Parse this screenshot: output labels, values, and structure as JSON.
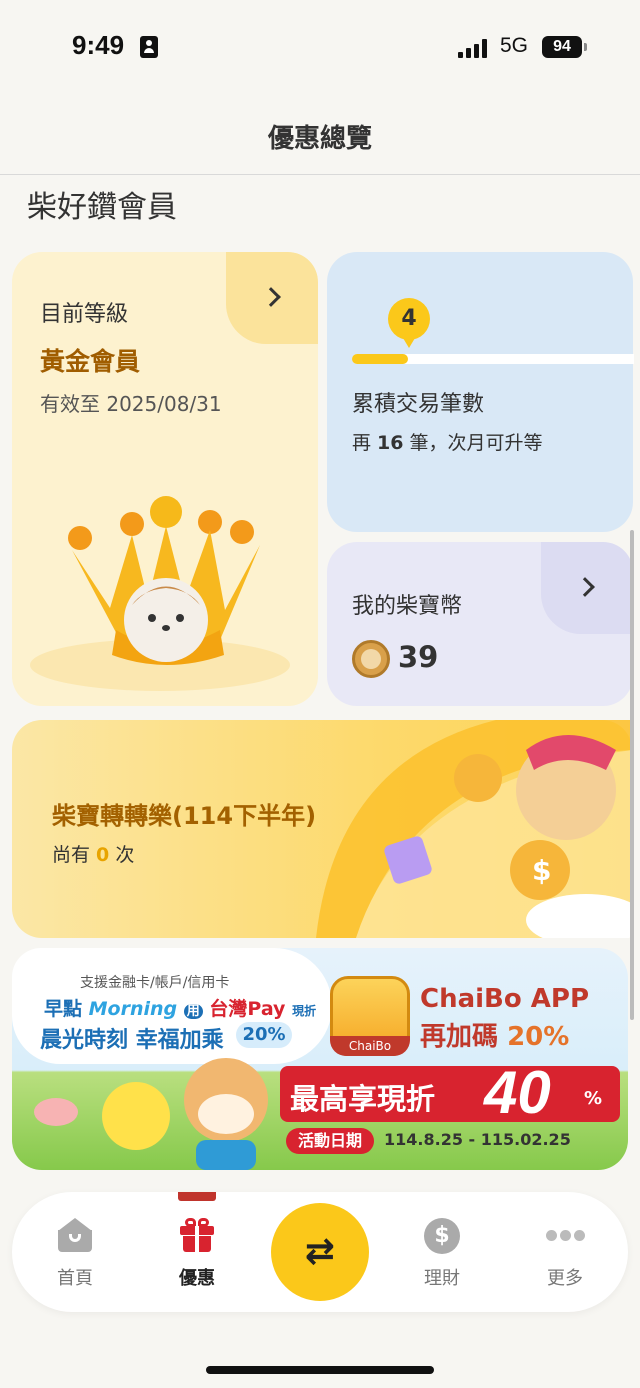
{
  "status_bar": {
    "time": "9:49",
    "network": "5G",
    "battery": "94"
  },
  "nav": {
    "title": "優惠總覽"
  },
  "section": {
    "title": "柴好鑽會員"
  },
  "level_card": {
    "label": "目前等級",
    "level": "黃金會員",
    "valid_until": "有效至 2025/08/31"
  },
  "transactions_card": {
    "count": "4",
    "progress": 0.2,
    "title": "累積交易筆數",
    "sub_prefix": "再 ",
    "sub_remaining": "16",
    "sub_suffix": " 筆，次月可升等"
  },
  "coin_card": {
    "title": "我的柴寶幣",
    "balance": "39"
  },
  "wheel_card": {
    "title": "柴寶轉轉樂(114下半年)",
    "sub_prefix": "尚有 ",
    "sub_count": "0",
    "sub_suffix": " 次"
  },
  "banner": {
    "top_line": "支援金融卡/帳戶/信用卡",
    "line1_a": "早點",
    "line1_b": "Morning",
    "line1_c": "用",
    "line1_d": "台灣Pay",
    "line1_e": "現折",
    "line2": "晨光時刻 幸福加乘",
    "line2_pct": "20%",
    "app_label": "ChaiBo",
    "app_title": "ChaiBo APP",
    "app_sub": "再加碼 ",
    "app_sub_pct": "20%",
    "max_text": "最高享現折",
    "max_num": "40",
    "max_unit": "%",
    "date_label": "活動日期",
    "date_range": "114.8.25 - 115.02.25"
  },
  "tabbar": {
    "home": "首頁",
    "offers": "優惠",
    "transfer_symbol": "⇄",
    "finance_symbol": "$",
    "finance": "理財",
    "more": "更多"
  }
}
